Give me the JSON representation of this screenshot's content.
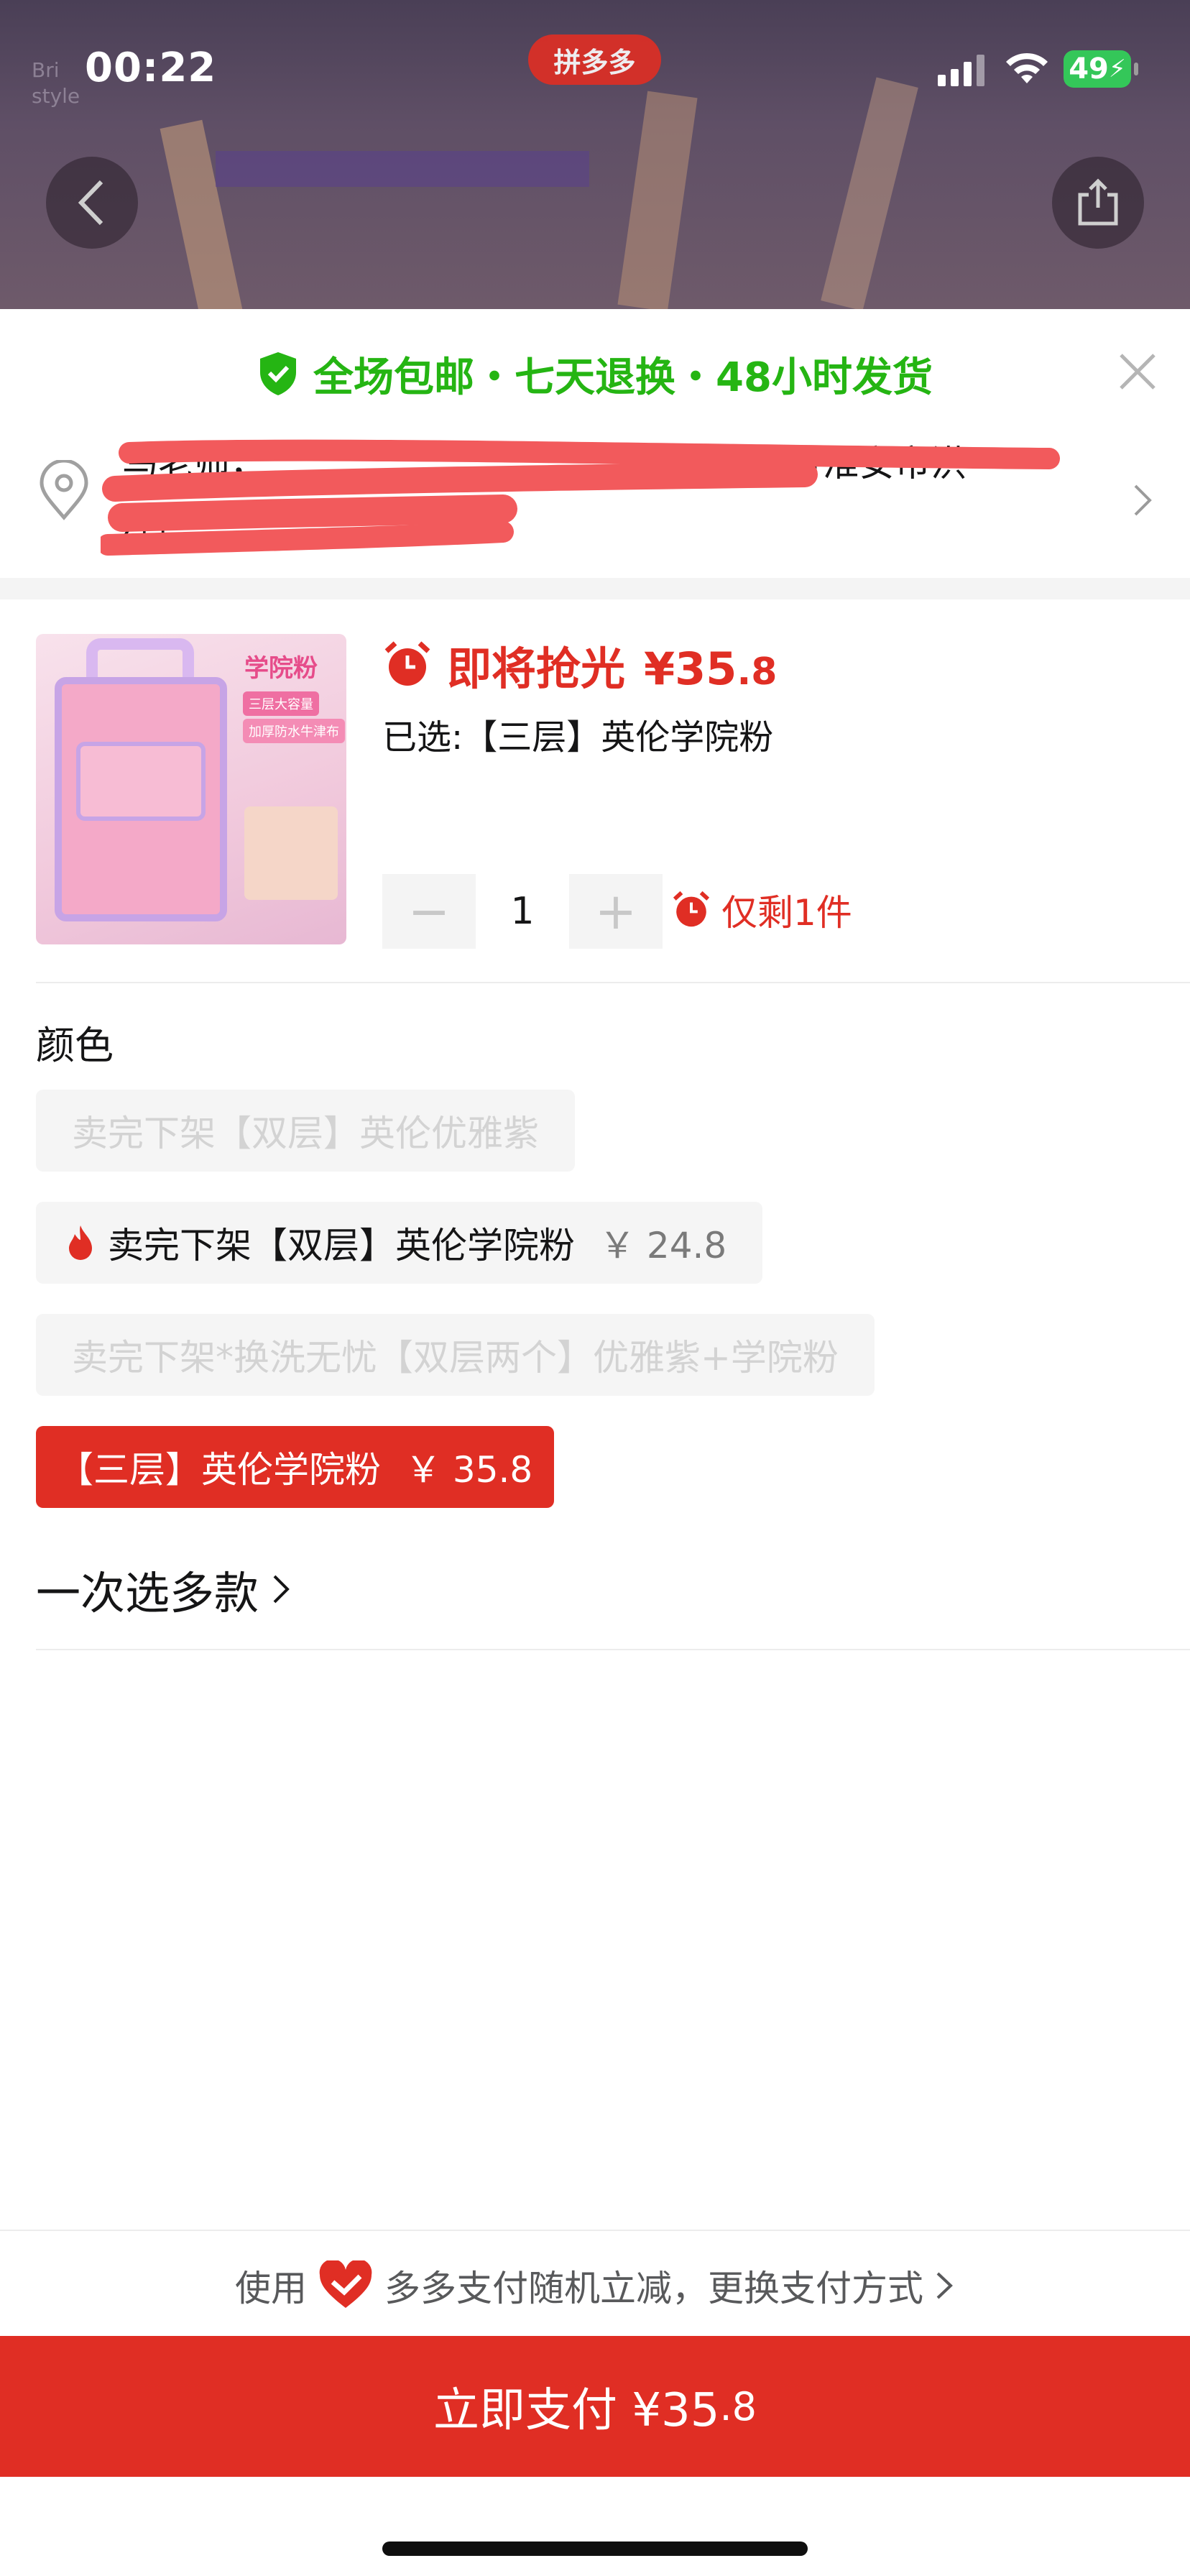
{
  "status_bar": {
    "time": "00:22",
    "battery": "49"
  },
  "header": {
    "app_badge": "拼多多",
    "brand_text": "Bri\nstyle"
  },
  "promo": {
    "text": "全场包邮・七天退换・48小时发货"
  },
  "address": {
    "text": "马老师，　　　　　　　　　　　　　　　省淮安市洪泽区"
  },
  "product": {
    "flash_label": "即将抢光",
    "price_currency": "¥",
    "price_main": "35",
    "price_decimal": ".8",
    "selected_prefix": "已选:",
    "selected_value": "【三层】英伦学院粉",
    "quantity": "1",
    "minus": "−",
    "plus": "+",
    "remain": "仅剩1件",
    "thumb_title": "学院粉",
    "thumb_tag1": "三层大容量",
    "thumb_tag2": "加厚防水牛津布"
  },
  "colors": {
    "label": "颜色",
    "options": [
      {
        "label": "卖完下架【双层】英伦优雅紫",
        "price": "",
        "state": "disabled"
      },
      {
        "label": "卖完下架【双层】英伦学院粉",
        "price": "￥ 24.8",
        "state": "normal"
      },
      {
        "label": "卖完下架*换洗无忧【双层两个】优雅紫+学院粉",
        "price": "",
        "state": "disabled"
      },
      {
        "label": "【三层】英伦学院粉",
        "price": "￥ 35.8",
        "state": "selected"
      }
    ]
  },
  "multi_select": {
    "label": "一次选多款"
  },
  "pay_tip": {
    "prefix": "使用",
    "suffix": "多多支付随机立减，更换支付方式"
  },
  "pay_button": {
    "label": "立即支付 ¥35",
    "decimal": ".8"
  },
  "colors_theme": {
    "accent": "#e02e24",
    "promo_green": "#25b513",
    "battery_green": "#34c759"
  }
}
